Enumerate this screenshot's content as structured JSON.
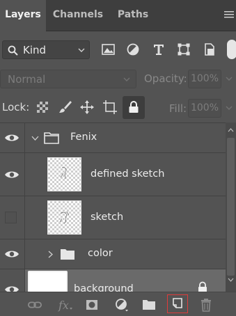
{
  "tabs": [
    {
      "label": "Layers",
      "active": true
    },
    {
      "label": "Channels",
      "active": false
    },
    {
      "label": "Paths",
      "active": false
    }
  ],
  "filter": {
    "kind_label": "Kind"
  },
  "blend": {
    "mode": "Normal",
    "opacity_label": "Opacity:",
    "opacity_value": "100%"
  },
  "lock": {
    "label": "Lock:",
    "fill_label": "Fill:",
    "fill_value": "100%"
  },
  "layers": [
    {
      "name": "Fenix",
      "type": "group",
      "expanded": true,
      "visible": true
    },
    {
      "name": "defined sketch",
      "type": "layer",
      "visible": true
    },
    {
      "name": "sketch",
      "type": "layer",
      "visible": false
    },
    {
      "name": "color",
      "type": "group",
      "expanded": false,
      "visible": true
    },
    {
      "name": "background",
      "type": "layer",
      "visible": true,
      "locked": true,
      "selected": true
    }
  ],
  "colors": {
    "highlight": "#e03c3c",
    "panel_bg": "#535353",
    "tab_bg": "#3e3e3e",
    "selected_row": "#6a6a6a"
  }
}
